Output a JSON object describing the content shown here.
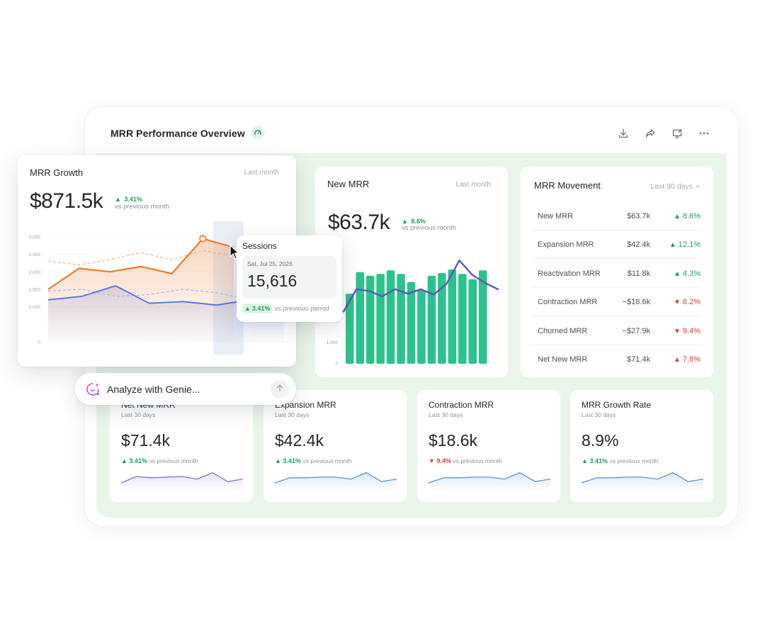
{
  "header": {
    "title": "MRR Performance Overview",
    "actions": [
      "download-icon",
      "share-icon",
      "present-icon",
      "more-icon"
    ]
  },
  "growth_card": {
    "title": "MRR Growth",
    "period": "Last month",
    "value": "$871.5k",
    "delta": "3.41%",
    "vs": "vs previous month",
    "y_ticks": [
      "3,000",
      "2,500",
      "2,000",
      "1,500",
      "1,000",
      "0"
    ],
    "colors": {
      "current": "#f07a2c",
      "previous": "#4f6fe6"
    }
  },
  "tooltip": {
    "title": "Sessions",
    "date": "Sat, Jul 25, 2026",
    "value": "15,616",
    "delta": "3.41%",
    "vs": "vs previous period"
  },
  "genie": {
    "placeholder": "Analyze with Genie..."
  },
  "new_mrr_card": {
    "title": "New MRR",
    "period": "Last month",
    "value": "$63.7k",
    "delta": "8.6%",
    "vs": "vs previous month",
    "y_ticks": [
      "1,000",
      "0"
    ],
    "colors": {
      "bars": "#2cc28b",
      "line": "#5b57b8"
    }
  },
  "movement_card": {
    "title": "MRR Movement",
    "period": "Last 30 days",
    "rows": [
      {
        "label": "New MRR",
        "value": "$63.7k",
        "delta": "8.6%",
        "dir": "up"
      },
      {
        "label": "Expansion MRR",
        "value": "$42.4k",
        "delta": "12.1%",
        "dir": "up"
      },
      {
        "label": "Reactivation MRR",
        "value": "$11.8k",
        "delta": "4.3%",
        "dir": "up"
      },
      {
        "label": "Contraction MRR",
        "value": "−$18.6k",
        "delta": "6.2%",
        "dir": "down"
      },
      {
        "label": "Churned MRR",
        "value": "−$27.9k",
        "delta": "9.4%",
        "dir": "down"
      },
      {
        "label": "Net New MRR",
        "value": "$71.4k",
        "delta": "7.8%",
        "dir": "up-red"
      }
    ]
  },
  "small_cards": [
    {
      "title": "Net New MRR",
      "sub": "Last 30 days",
      "value": "$71.4k",
      "delta": "3.41%",
      "dir": "up",
      "vs": "vs previous month",
      "color": "#8b6fc4"
    },
    {
      "title": "Expansion MRR",
      "sub": "Last 30 days",
      "value": "$42.4k",
      "delta": "3.41%",
      "dir": "up",
      "vs": "vs previous month",
      "color": "#5b93c9"
    },
    {
      "title": "Contraction MRR",
      "sub": "Last 30 days",
      "value": "$18.6k",
      "delta": "9.4%",
      "dir": "down",
      "vs": "vs previous month",
      "color": "#5b93c9"
    },
    {
      "title": "MRR Growth Rate",
      "sub": "Last 30 days",
      "value": "8.9%",
      "delta": "3.41%",
      "dir": "up",
      "vs": "vs previous month",
      "color": "#5b93c9"
    }
  ],
  "chart_data": [
    {
      "type": "line",
      "title": "MRR Growth",
      "ylim": [
        0,
        3000
      ],
      "series": [
        {
          "values": [
            1500,
            2100,
            2000,
            2150,
            1950,
            2950,
            2700
          ]
        },
        {
          "values": [
            2300,
            2200,
            2350,
            2550,
            2350,
            2600,
            2450
          ]
        },
        {
          "values": [
            1200,
            1300,
            1600,
            1100,
            1150,
            1050,
            1200,
            800
          ]
        },
        {
          "values": [
            1450,
            1500,
            1300,
            1350,
            1500,
            1400,
            1200,
            1150
          ]
        }
      ]
    },
    {
      "type": "bar",
      "title": "New MRR",
      "values": [
        780,
        1020,
        980,
        1000,
        1040,
        1000,
        910,
        820,
        980,
        1010,
        1050,
        1000,
        940,
        1040
      ],
      "line": [
        580,
        830,
        810,
        750,
        830,
        780,
        830,
        770,
        890,
        1150,
        990,
        900,
        830
      ]
    }
  ]
}
